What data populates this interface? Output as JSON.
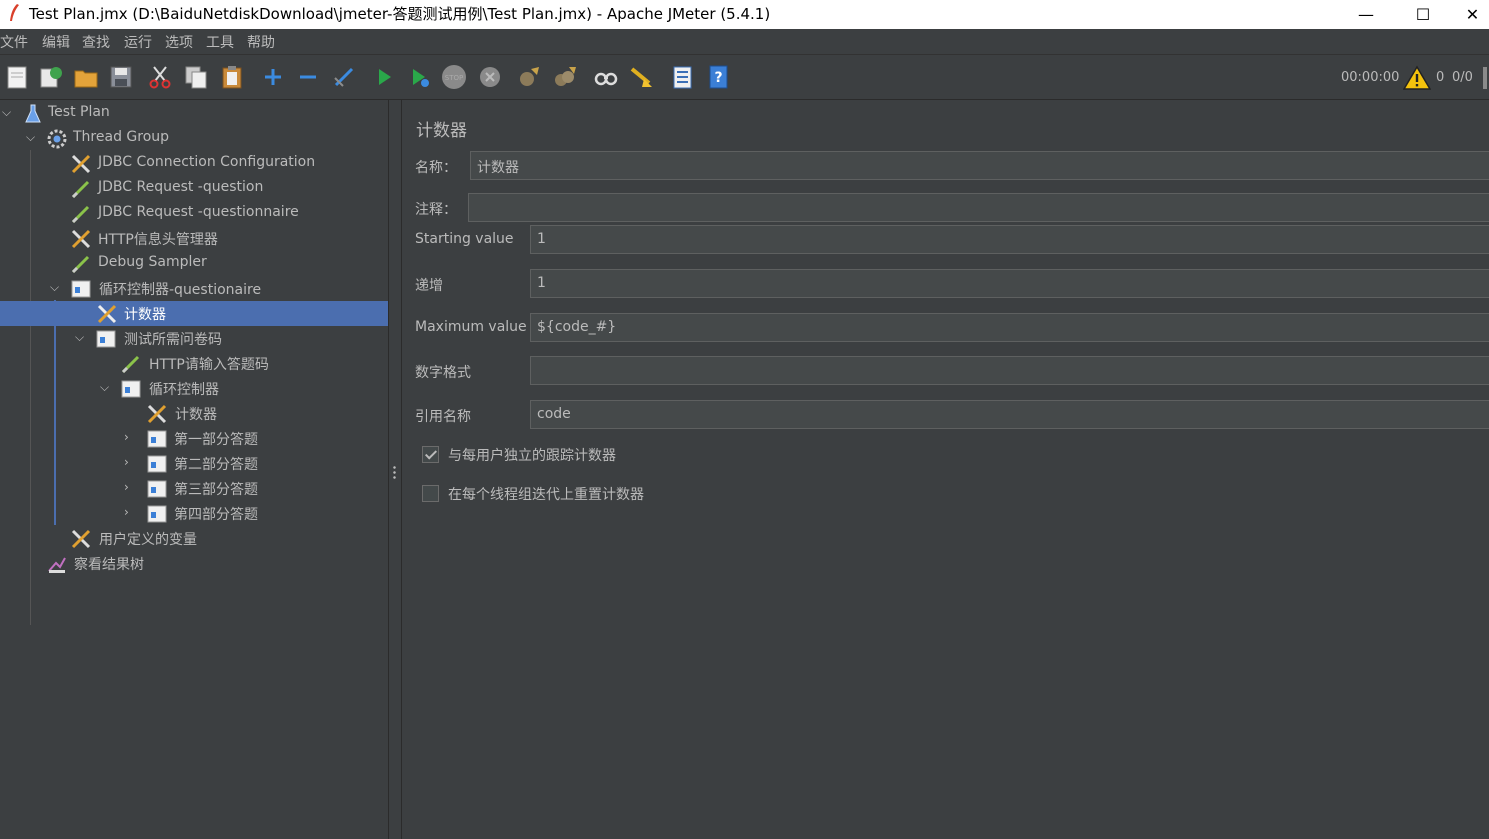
{
  "window": {
    "title": "Test Plan.jmx (D:\\BaiduNetdiskDownload\\jmeter-答题测试用例\\Test Plan.jmx) - Apache JMeter (5.4.1)",
    "minimize": "—",
    "maximize": "☐",
    "close": "✕"
  },
  "menu": [
    "文件",
    "编辑",
    "查找",
    "运行",
    "选项",
    "工具",
    "帮助"
  ],
  "toolbar": {
    "icons": [
      "new-icon",
      "templates-icon",
      "open-icon",
      "save-icon",
      "cut-icon",
      "copy-icon",
      "paste-icon",
      "expand-icon",
      "collapse-icon",
      "toggle-icon",
      "start-icon",
      "start-no-pause-icon",
      "stop-icon",
      "shutdown-icon",
      "clear-icon",
      "clear-all-icon",
      "search-icon",
      "reset-search-icon",
      "function-helper-icon",
      "help-icon"
    ],
    "timer": "00:00:00",
    "error_count": "0",
    "threads": "0/0"
  },
  "tree": [
    {
      "label": "Test Plan",
      "icon": "test-plan-icon"
    },
    {
      "label": "Thread Group",
      "icon": "thread-group-icon"
    },
    {
      "label": "JDBC Connection Configuration",
      "icon": "config-element-icon"
    },
    {
      "label": "JDBC Request -question",
      "icon": "sampler-icon"
    },
    {
      "label": "JDBC Request -questionnaire",
      "icon": "sampler-icon"
    },
    {
      "label": "HTTP信息头管理器",
      "icon": "config-element-icon"
    },
    {
      "label": "Debug Sampler",
      "icon": "sampler-icon"
    },
    {
      "label": "循环控制器-questionaire",
      "icon": "controller-icon"
    },
    {
      "label": "计数器",
      "icon": "config-element-icon"
    },
    {
      "label": "测试所需问卷码",
      "icon": "controller-icon"
    },
    {
      "label": "HTTP请输入答题码",
      "icon": "sampler-icon"
    },
    {
      "label": "循环控制器",
      "icon": "controller-icon"
    },
    {
      "label": "计数器",
      "icon": "config-element-icon"
    },
    {
      "label": "第一部分答题",
      "icon": "controller-icon"
    },
    {
      "label": "第二部分答题",
      "icon": "controller-icon"
    },
    {
      "label": "第三部分答题",
      "icon": "controller-icon"
    },
    {
      "label": "第四部分答题",
      "icon": "controller-icon"
    },
    {
      "label": "用户定义的变量",
      "icon": "config-element-icon"
    },
    {
      "label": "察看结果树",
      "icon": "listener-icon"
    }
  ],
  "panel": {
    "title": "计数器",
    "name_label": "名称：",
    "name_value": "计数器",
    "comment_label": "注释：",
    "comment_value": "",
    "start_label": "Starting value",
    "start_value": "1",
    "increment_label": "递增",
    "increment_value": "1",
    "max_label": "Maximum value",
    "max_value": "${code_#}",
    "format_label": "数字格式",
    "format_value": "",
    "ref_label": "引用名称",
    "ref_value": "code",
    "per_user_label": "与每用户独立的跟踪计数器",
    "per_user_checked": true,
    "reset_label": "在每个线程组迭代上重置计数器",
    "reset_checked": false
  }
}
